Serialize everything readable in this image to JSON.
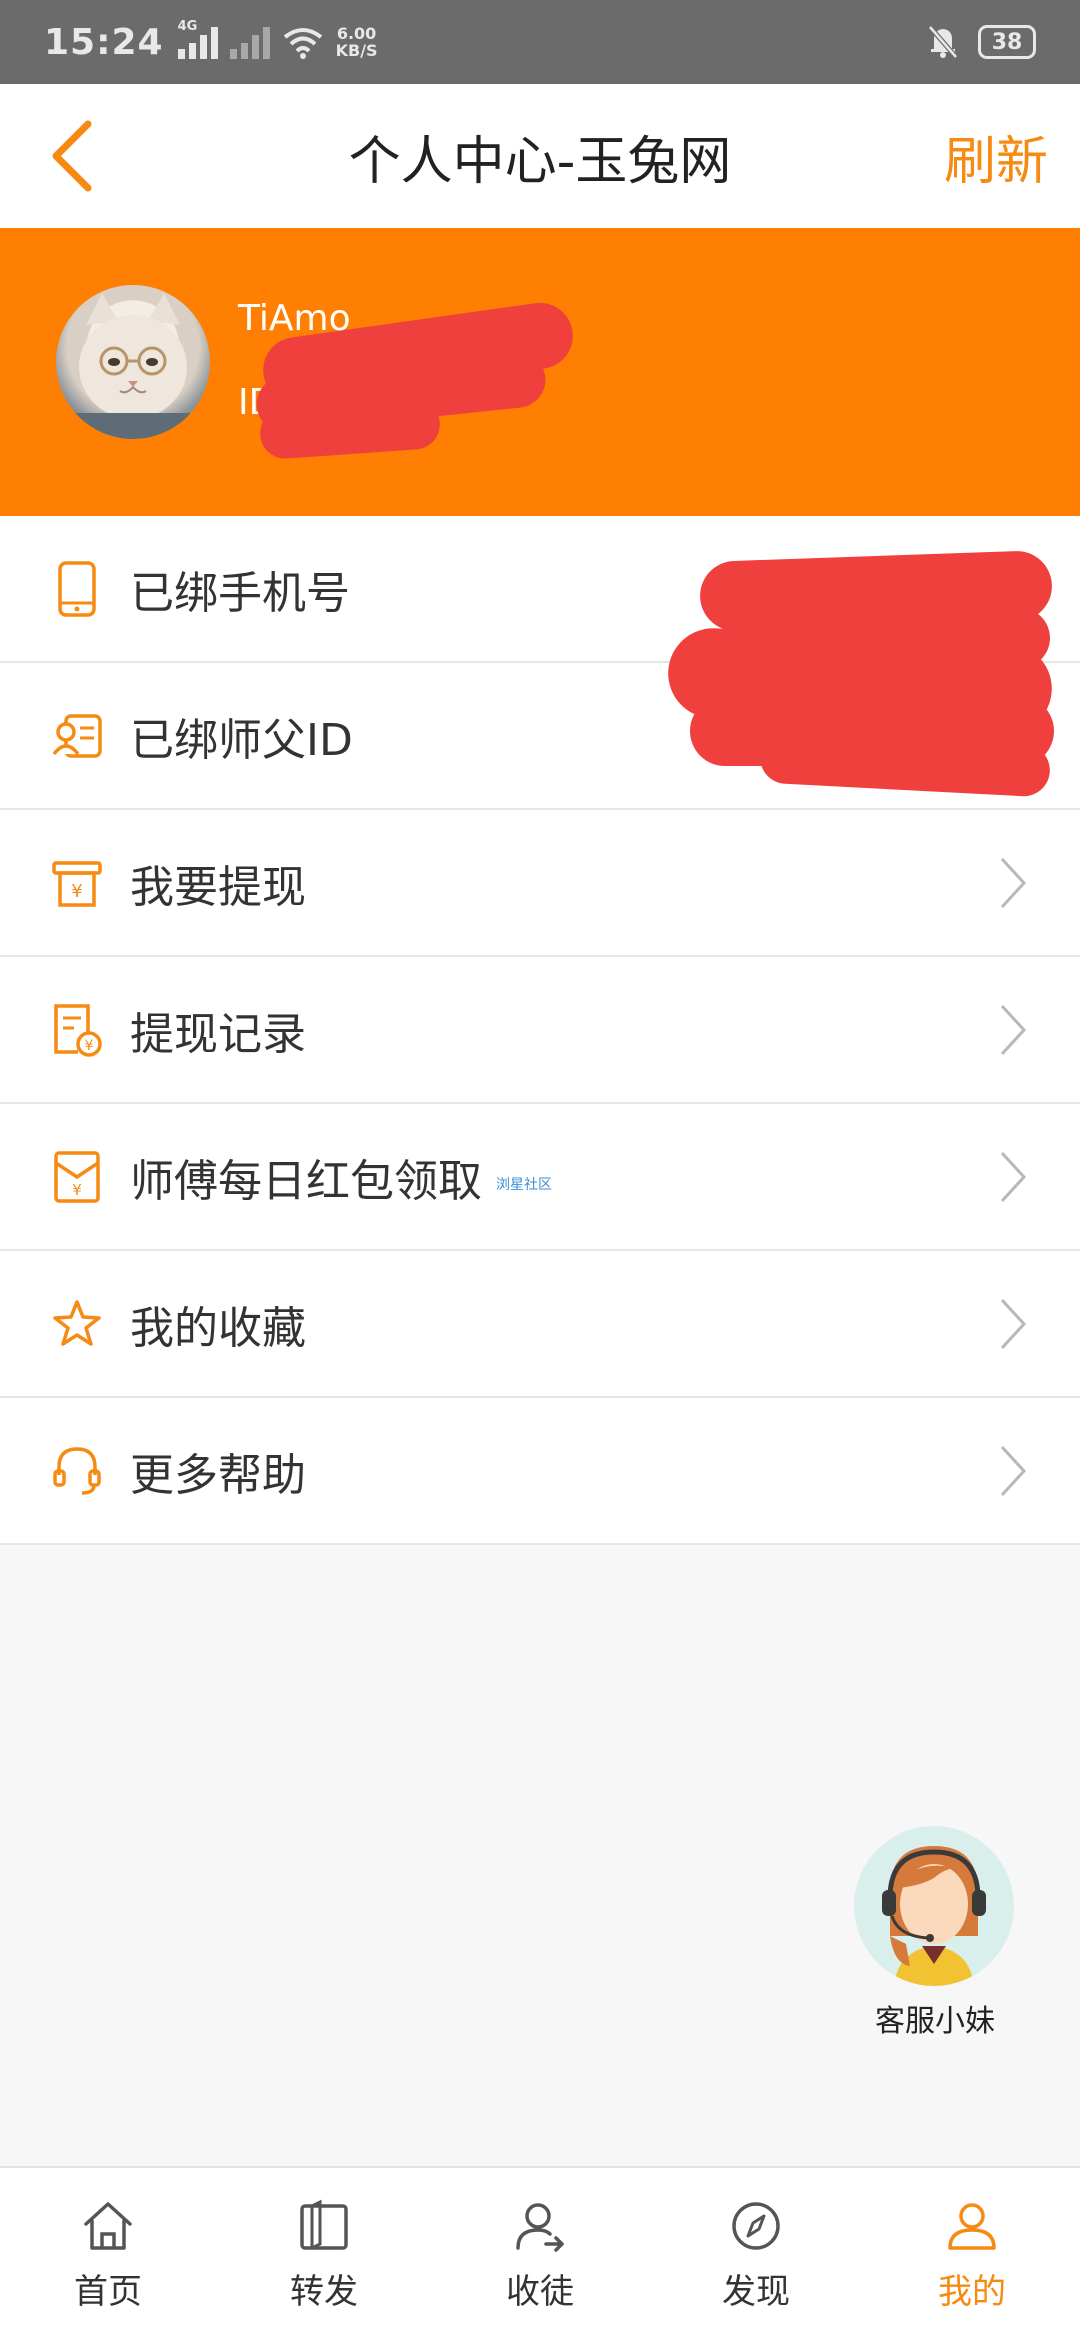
{
  "status_bar": {
    "time": "15:24",
    "network_type": "4G",
    "net_speed_value": "6.00",
    "net_speed_unit": "KB/S",
    "battery": "38"
  },
  "header": {
    "title": "个人中心-玉兔网",
    "refresh_label": "刷新",
    "accent_color": "#f68a12"
  },
  "profile": {
    "username": "TiAmo",
    "id_label": "ID",
    "banner_color": "#fe7f02"
  },
  "menu": [
    {
      "label": "已绑手机号",
      "icon": "phone-icon",
      "chevron": false
    },
    {
      "label": "已绑师父ID",
      "icon": "contact-card-icon",
      "chevron": false
    },
    {
      "label": "我要提现",
      "icon": "withdraw-icon",
      "chevron": true
    },
    {
      "label": "提现记录",
      "icon": "record-icon",
      "chevron": true
    },
    {
      "label": "师傅每日红包领取",
      "icon": "red-envelope-icon",
      "chevron": true,
      "tag": "浏星社区"
    },
    {
      "label": "我的收藏",
      "icon": "star-icon",
      "chevron": true
    },
    {
      "label": "更多帮助",
      "icon": "headset-icon",
      "chevron": true
    }
  ],
  "service": {
    "label": "客服小妹"
  },
  "tabs": [
    {
      "label": "首页",
      "icon": "home-icon",
      "active": false
    },
    {
      "label": "转发",
      "icon": "share-book-icon",
      "active": false
    },
    {
      "label": "收徒",
      "icon": "add-user-icon",
      "active": false
    },
    {
      "label": "发现",
      "icon": "compass-icon",
      "active": false
    },
    {
      "label": "我的",
      "icon": "profile-icon",
      "active": true
    }
  ]
}
